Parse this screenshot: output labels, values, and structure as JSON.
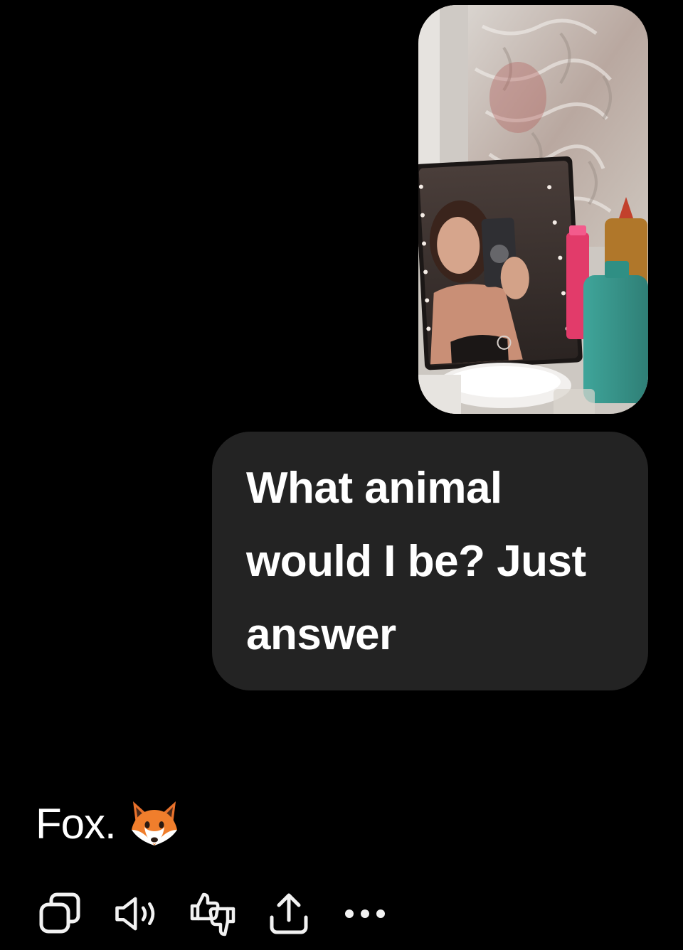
{
  "conversation": {
    "user_photo": {
      "icon": "photo-attachment"
    },
    "user_message": {
      "text": "What animal would I be? Just answer"
    },
    "assistant_message": {
      "text": "Fox.",
      "emoji_icon": "fox-face-icon"
    }
  },
  "toolbar": {
    "actions": [
      {
        "icon": "copy-icon"
      },
      {
        "icon": "speaker-icon"
      },
      {
        "icon": "thumbs-feedback-icon"
      },
      {
        "icon": "share-icon"
      },
      {
        "icon": "more-options-icon"
      }
    ]
  },
  "colors": {
    "background": "#000000",
    "user_bubble": "#232323",
    "text": "#ffffff",
    "icon": "#f2f2f2"
  }
}
